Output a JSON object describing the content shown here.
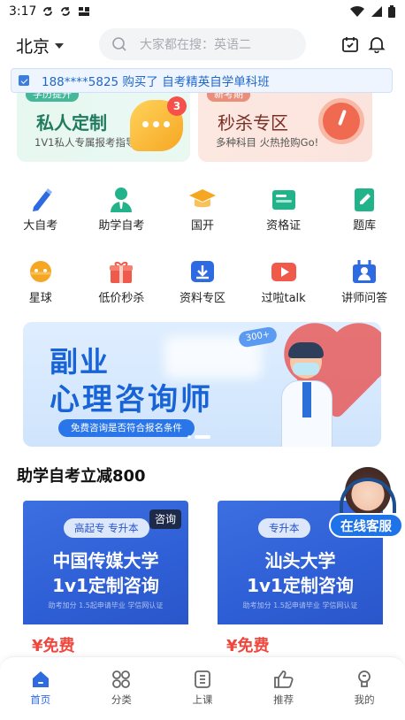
{
  "status_bar": {
    "time": "3:17"
  },
  "header": {
    "city": "北京",
    "search_placeholder": "大家都在搜：英语二"
  },
  "notice": {
    "text": "188****5825 购买了 自考精英自学单科班"
  },
  "promos": [
    {
      "tag": "学历提升",
      "title": "私人定制",
      "subtitle": "1V1私人专属报考指导",
      "badge": "3"
    },
    {
      "tag": "新考期",
      "title": "秒杀专区",
      "subtitle": "多种科目 火热抢购Go!"
    }
  ],
  "grid": {
    "row1": [
      {
        "label": "大自考",
        "icon": "pen-icon",
        "color": "#2f6be0"
      },
      {
        "label": "助学自考",
        "icon": "teacher-icon",
        "color": "#22b38a"
      },
      {
        "label": "国开",
        "icon": "graduation-cap-icon",
        "color": "#f5a623"
      },
      {
        "label": "资格证",
        "icon": "certificate-icon",
        "color": "#22b38a"
      },
      {
        "label": "题库",
        "icon": "question-bank-icon",
        "color": "#22b38a"
      }
    ],
    "row2": [
      {
        "label": "星球",
        "icon": "planet-icon",
        "color": "#f5a623"
      },
      {
        "label": "低价秒杀",
        "icon": "gift-icon",
        "color": "#f05a4a"
      },
      {
        "label": "资料专区",
        "icon": "download-icon",
        "color": "#2f6be0"
      },
      {
        "label": "过啦talk",
        "icon": "play-icon",
        "color": "#f05a4a"
      },
      {
        "label": "讲师问答",
        "icon": "lecturer-qa-icon",
        "color": "#2f6be0"
      }
    ]
  },
  "banner": {
    "line1": "副业",
    "line2": "心理咨询师",
    "caption": "免费咨询是否符合报名条件",
    "tag": "300+"
  },
  "section": {
    "title": "助学自考立减800"
  },
  "cards": [
    {
      "pill": "高起专 专升本",
      "consult": "咨询",
      "school": "中国传媒大学",
      "subtitle": "1v1定制咨询",
      "small": "助考加分 1.5起申请毕业 学信网认证",
      "price": "¥免费"
    },
    {
      "pill": "专升本",
      "school": "汕头大学",
      "subtitle": "1v1定制咨询",
      "small": "助考加分 1.5起申请毕业 学信网认证",
      "price": "¥免费"
    }
  ],
  "customer_service": {
    "label": "在线客服"
  },
  "tabs": [
    {
      "label": "首页",
      "icon": "home-icon",
      "active": true
    },
    {
      "label": "分类",
      "icon": "category-icon"
    },
    {
      "label": "上课",
      "icon": "class-icon"
    },
    {
      "label": "推荐",
      "icon": "thumbs-up-icon"
    },
    {
      "label": "我的",
      "icon": "profile-icon"
    }
  ],
  "colors": {
    "accent": "#2f6be0",
    "price": "#f0463c"
  }
}
